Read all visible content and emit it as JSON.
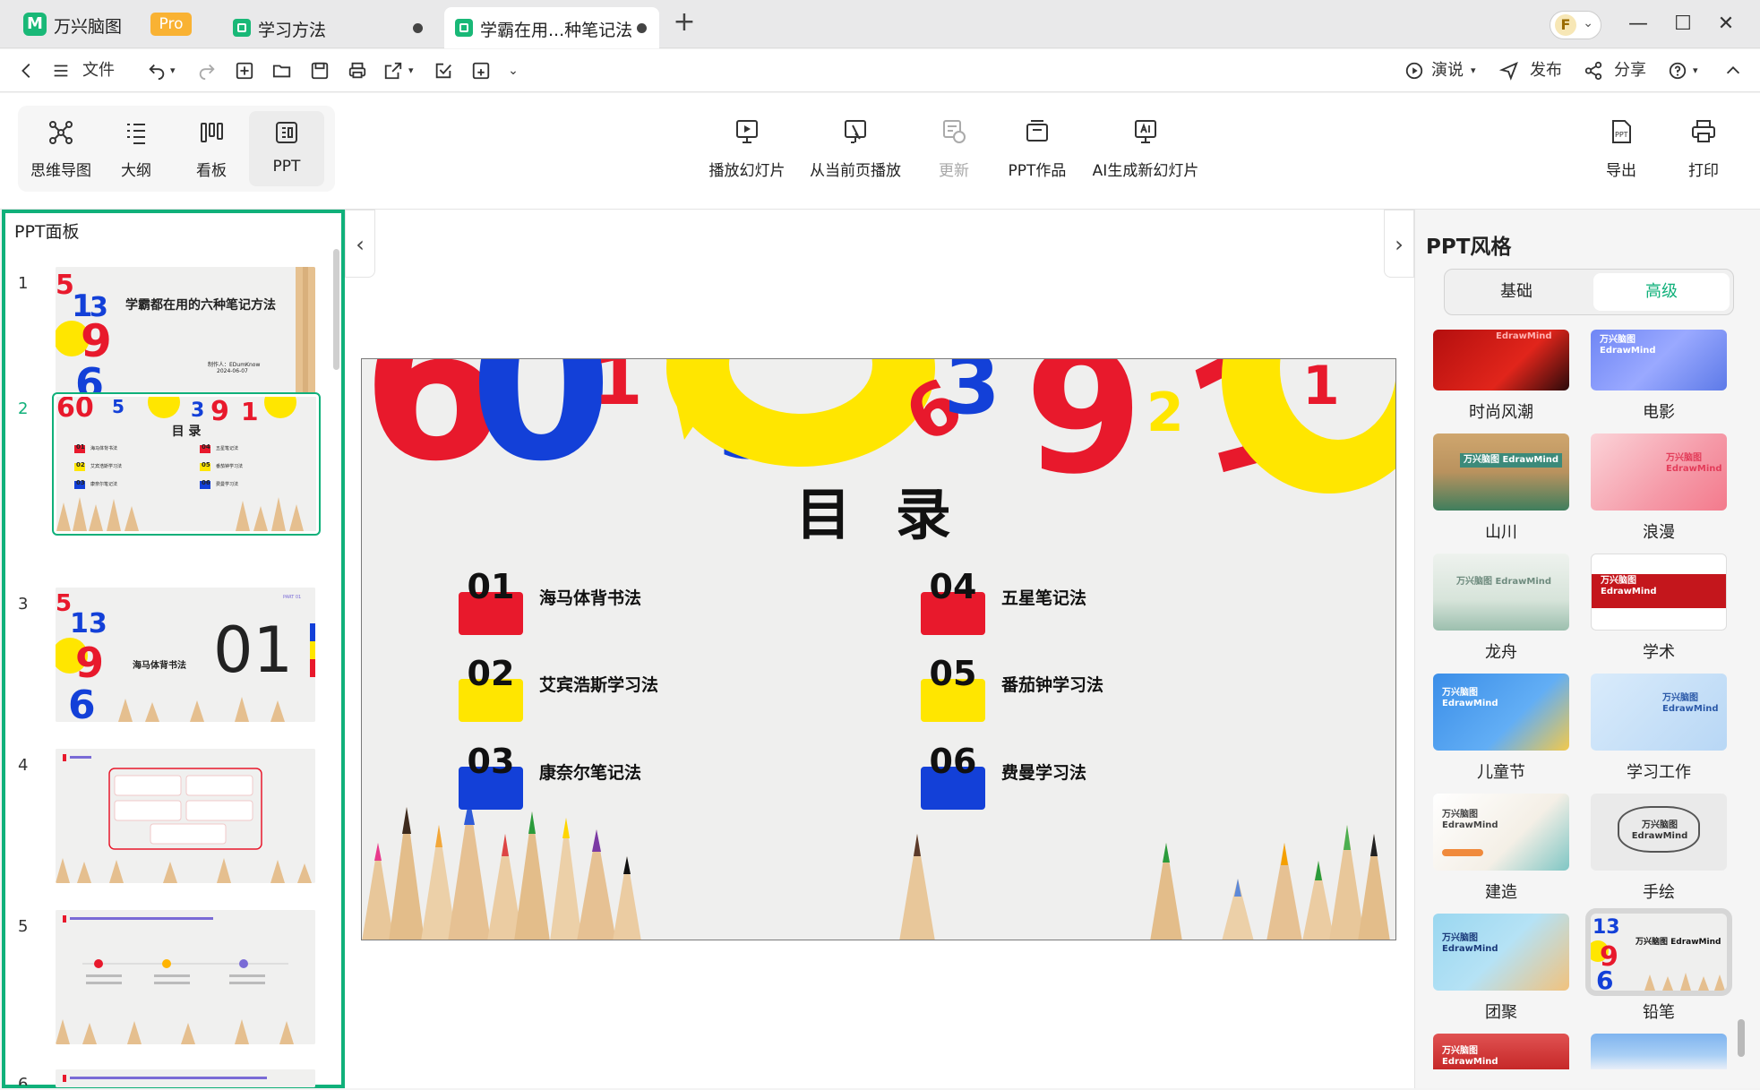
{
  "app": {
    "name": "万兴脑图",
    "badge": "Pro"
  },
  "tabs": [
    {
      "label": "学习方法",
      "active": false
    },
    {
      "label": "学霸在用...种笔记法",
      "active": true
    }
  ],
  "window": {
    "minimize": "—",
    "maximize": "☐",
    "close": "✕",
    "new_tab": "+"
  },
  "quickbar": {
    "file_label": "文件",
    "present_label": "演说",
    "publish_label": "发布",
    "share_label": "分享"
  },
  "view_switch": [
    {
      "label": "思维导图",
      "icon": "mindmap-icon"
    },
    {
      "label": "大纲",
      "icon": "outline-icon"
    },
    {
      "label": "看板",
      "icon": "kanban-icon"
    },
    {
      "label": "PPT",
      "icon": "ppt-icon",
      "active": true
    }
  ],
  "ribbon": [
    {
      "label": "播放幻灯片",
      "icon": "play-slides-icon"
    },
    {
      "label": "从当前页播放",
      "icon": "play-current-icon"
    },
    {
      "label": "更新",
      "icon": "update-icon",
      "disabled": true
    },
    {
      "label": "PPT作品",
      "icon": "ppt-works-icon"
    },
    {
      "label": "AI生成新幻灯片",
      "icon": "ai-slides-icon"
    },
    {
      "label": "导出",
      "icon": "export-icon"
    },
    {
      "label": "打印",
      "icon": "print-icon"
    }
  ],
  "left_panel": {
    "title": "PPT面板",
    "slides": [
      {
        "num": "1",
        "title": "学霸都在用的六种笔记方法",
        "author": "制作人：EDumKnow",
        "date": "2024-06-07"
      },
      {
        "num": "2",
        "title": "目 录",
        "active": true
      },
      {
        "num": "3",
        "title": "海马体背书法",
        "part": "01",
        "part_tag": "PART 01"
      },
      {
        "num": "4"
      },
      {
        "num": "5"
      },
      {
        "num": "6"
      }
    ]
  },
  "slide": {
    "title": "目 录",
    "items": [
      {
        "num": "01",
        "label": "海马体背书法",
        "color": "#e8192c"
      },
      {
        "num": "02",
        "label": "艾宾浩斯学习法",
        "color": "#ffe600"
      },
      {
        "num": "03",
        "label": "康奈尔笔记法",
        "color": "#1340d8"
      },
      {
        "num": "04",
        "label": "五星笔记法",
        "color": "#e8192c"
      },
      {
        "num": "05",
        "label": "番茄钟学习法",
        "color": "#ffe600"
      },
      {
        "num": "06",
        "label": "费曼学习法",
        "color": "#1340d8"
      }
    ]
  },
  "right_panel": {
    "title": "PPT风格",
    "segments": [
      {
        "label": "基础"
      },
      {
        "label": "高级",
        "active": true
      }
    ],
    "styles": [
      {
        "label": "时尚风潮",
        "card_text": "EdrawMind"
      },
      {
        "label": "电影",
        "card_text": "万兴脑图 EdrawMind"
      },
      {
        "label": "山川",
        "card_text": "万兴脑图 EdrawMind"
      },
      {
        "label": "浪漫",
        "card_text": "万兴脑图 EdrawMind"
      },
      {
        "label": "龙舟",
        "card_text": "万兴脑图 EdrawMind"
      },
      {
        "label": "学术",
        "card_text": "万兴脑图 EdrawMind"
      },
      {
        "label": "儿童节",
        "card_text": "万兴脑图 EdrawMind"
      },
      {
        "label": "学习工作",
        "card_text": "万兴脑图 EdrawMind"
      },
      {
        "label": "建造",
        "card_text": "万兴脑图 EdrawMind"
      },
      {
        "label": "手绘",
        "card_text": "万兴脑图 EdrawMind"
      },
      {
        "label": "团聚",
        "card_text": "万兴脑图 EdrawMind"
      },
      {
        "label": "铅笔",
        "card_text": "万兴脑图 EdrawMind",
        "selected": true
      },
      {
        "card_text": "万兴脑图 EdrawMind"
      },
      {
        "card_text": ""
      }
    ]
  },
  "colors": {
    "accent": "#10b07a",
    "red": "#e8192c",
    "yellow": "#ffe600",
    "blue": "#1340d8"
  }
}
